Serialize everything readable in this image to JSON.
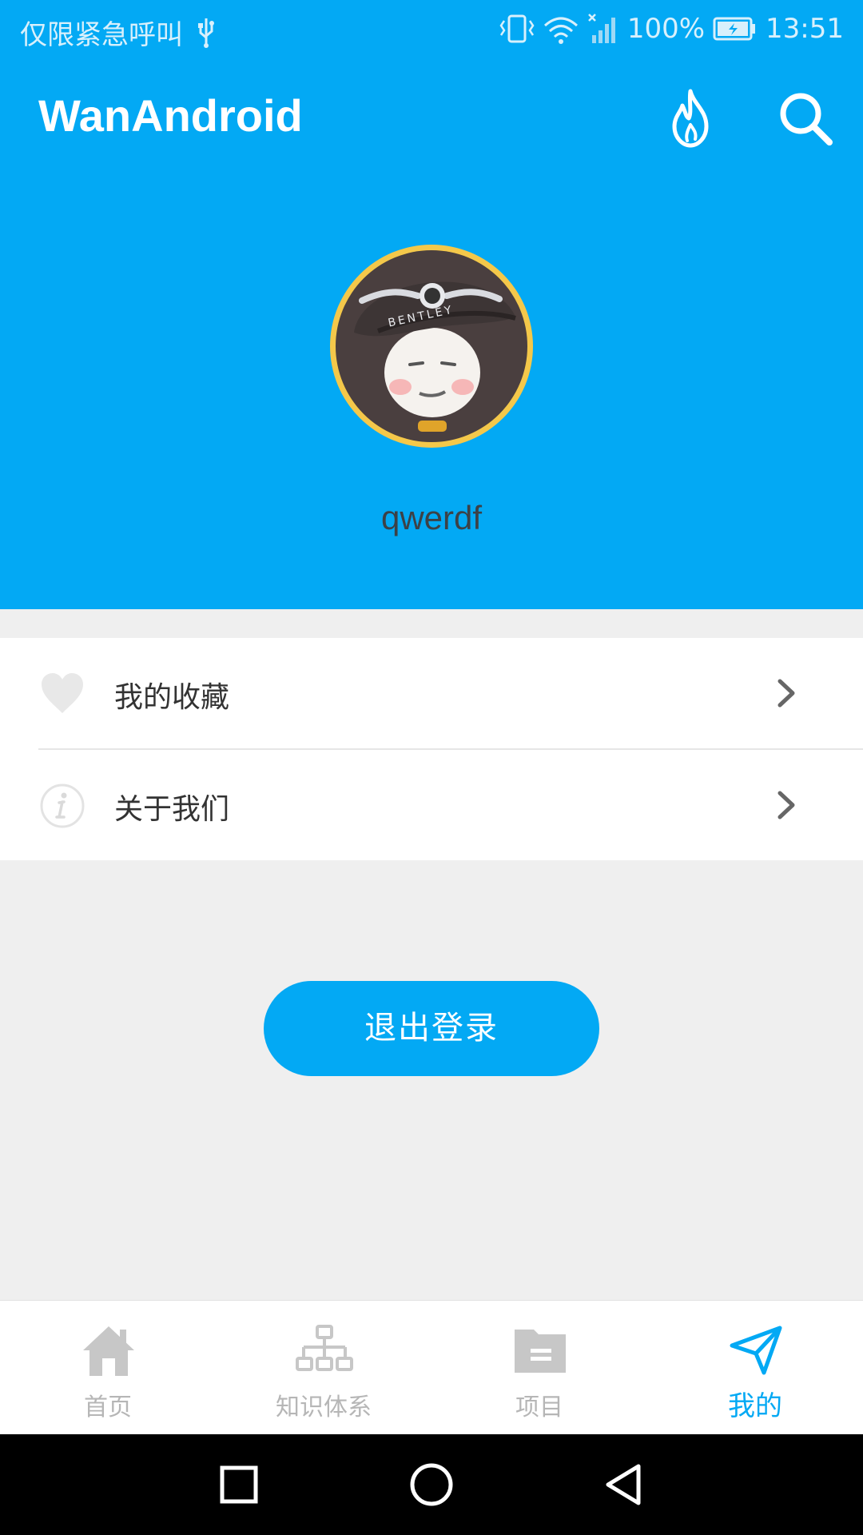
{
  "status_bar": {
    "carrier_text": "仅限紧急呼叫",
    "battery": "100%",
    "time": "13:51"
  },
  "toolbar": {
    "title": "WanAndroid",
    "icons": [
      "fire-icon",
      "search-icon"
    ]
  },
  "profile": {
    "username": "qwerdf",
    "avatar_badge_text": "BENTLEY"
  },
  "menu": {
    "items": [
      {
        "label": "我的收藏",
        "icon": "heart-icon"
      },
      {
        "label": "关于我们",
        "icon": "info-icon"
      }
    ]
  },
  "logout_label": "退出登录",
  "bottom_nav": {
    "active_index": 3,
    "items": [
      {
        "label": "首页",
        "icon": "home-icon"
      },
      {
        "label": "知识体系",
        "icon": "hierarchy-icon"
      },
      {
        "label": "项目",
        "icon": "folder-icon"
      },
      {
        "label": "我的",
        "icon": "send-icon"
      }
    ]
  },
  "colors": {
    "primary": "#03a9f4",
    "background": "#efefef",
    "inactive": "#b6b6b6"
  }
}
